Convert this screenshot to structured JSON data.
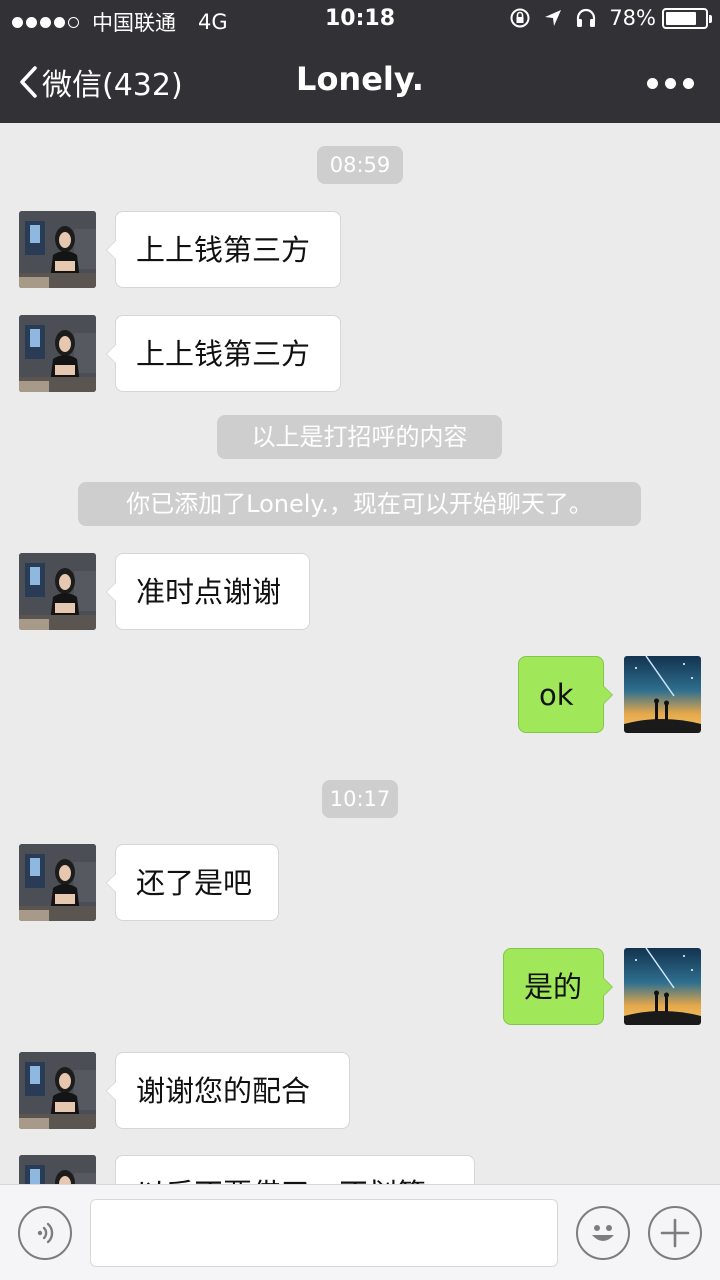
{
  "status_bar": {
    "carrier": "中国联通",
    "network": "4G",
    "time": "10:18",
    "battery_percent": "78%",
    "battery_level": 0.78
  },
  "nav": {
    "back_label": "微信(432)",
    "title": "Lonely."
  },
  "messages": {
    "ts1": "08:59",
    "m1": "上上钱第三方",
    "m2": "上上钱第三方",
    "sys1": "以上是打招呼的内容",
    "sys2": "你已添加了Lonely.，现在可以开始聊天了。",
    "m3": "准时点谢谢",
    "m4": "ok",
    "ts2": "10:17",
    "m5": "还了是吧",
    "m6": "是的",
    "m7": "谢谢您的配合",
    "m8": "以后不要借了，不划算"
  },
  "colors": {
    "header_bg": "#323236",
    "chat_bg": "#ebebeb",
    "outgoing_bubble": "#a0e75a",
    "incoming_bubble": "#ffffff"
  },
  "input": {
    "placeholder": ""
  }
}
